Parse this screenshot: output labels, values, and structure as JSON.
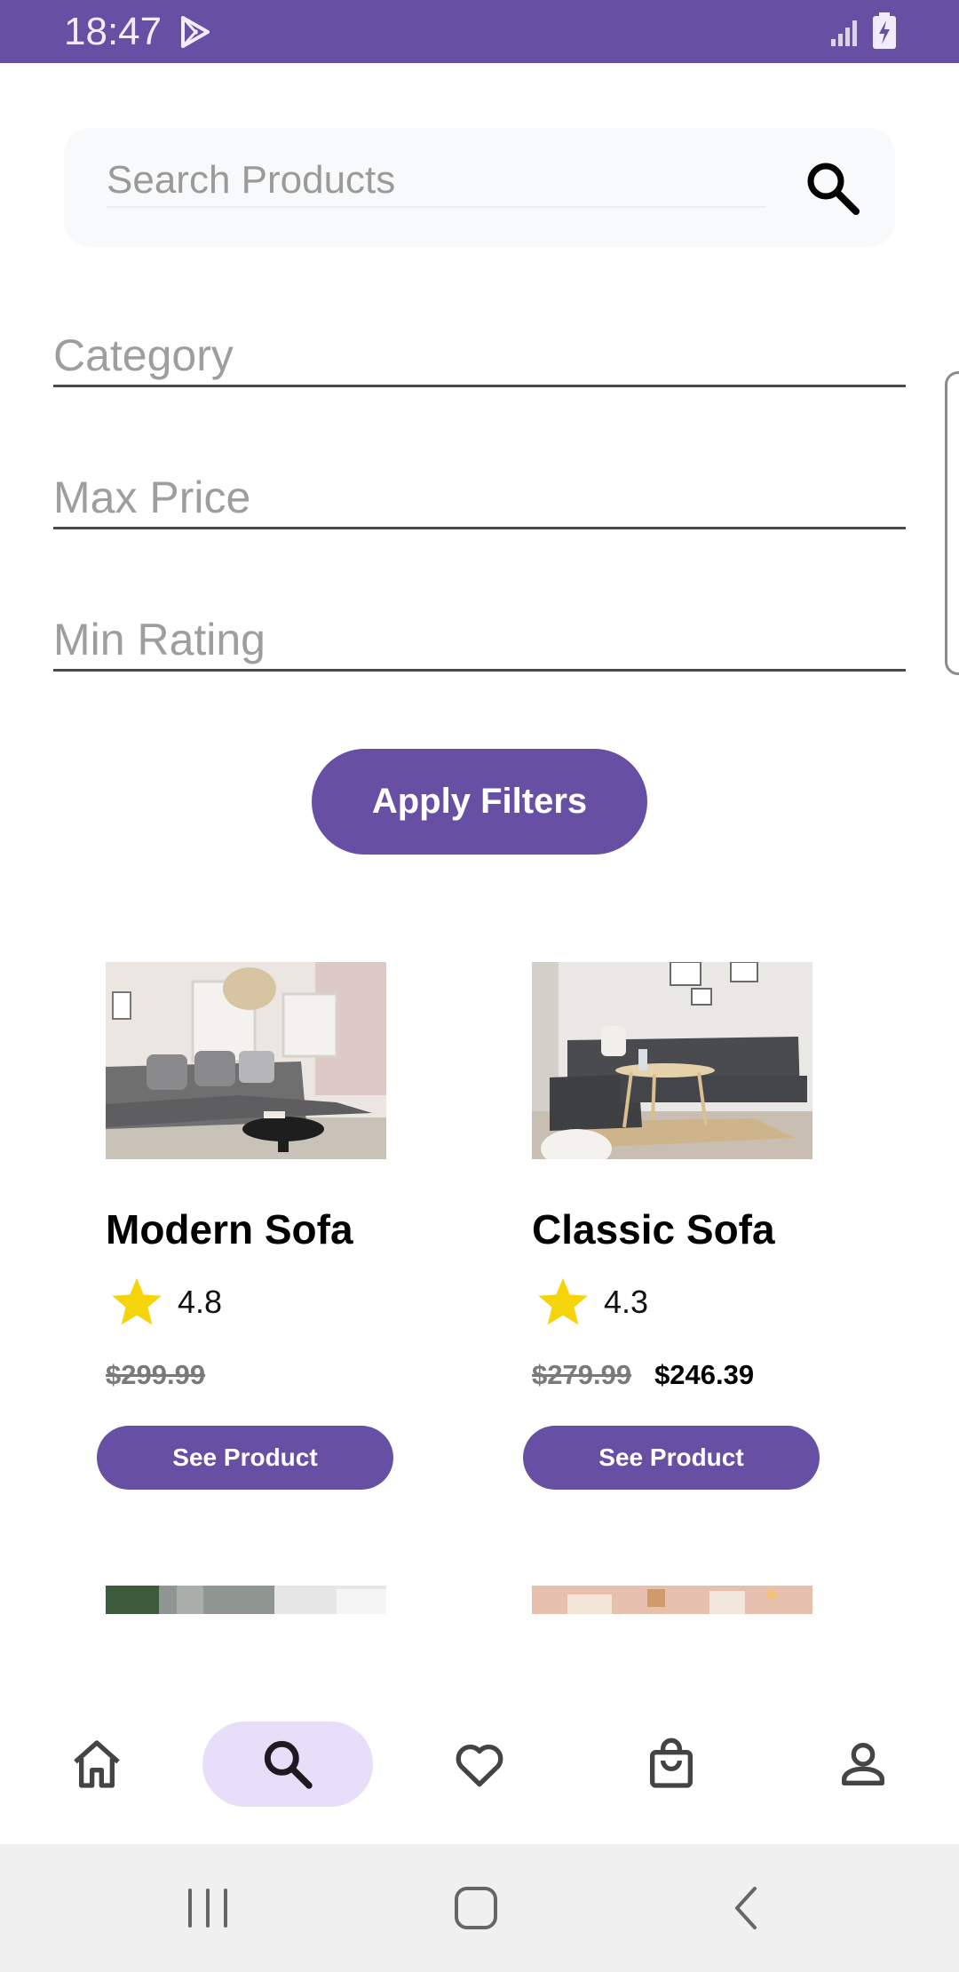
{
  "status_bar": {
    "time": "18:47",
    "icons": [
      "play-store-icon",
      "signal-icon",
      "battery-charging-icon"
    ],
    "bg_color": "#6750a4"
  },
  "search": {
    "placeholder": "Search Products",
    "value": "",
    "icon": "search-icon"
  },
  "filters": {
    "category_placeholder": "Category",
    "max_price_placeholder": "Max Price",
    "min_rating_placeholder": "Min Rating",
    "apply_label": "Apply Filters"
  },
  "products": [
    {
      "name": "Modern Sofa",
      "rating": "4.8",
      "price": "$299.99",
      "sale_price": "",
      "button_label": "See Product"
    },
    {
      "name": "Classic Sofa",
      "rating": "4.3",
      "price": "$279.99",
      "sale_price": "$246.39",
      "button_label": "See Product"
    }
  ],
  "bottom_nav": {
    "items": [
      {
        "icon": "home-icon",
        "active": false
      },
      {
        "icon": "search-icon",
        "active": true
      },
      {
        "icon": "heart-icon",
        "active": false
      },
      {
        "icon": "shopping-bag-icon",
        "active": false
      },
      {
        "icon": "profile-icon",
        "active": false
      }
    ]
  },
  "system_nav": [
    "recents-icon",
    "home-button-icon",
    "back-icon"
  ],
  "colors": {
    "primary": "#6750a4",
    "active_pill": "#e8defa",
    "star": "#f6d40b"
  }
}
